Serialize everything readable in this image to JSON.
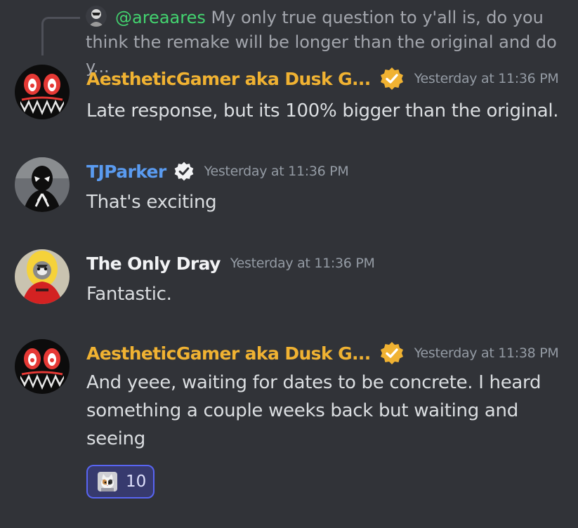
{
  "reply": {
    "author": "@areaares",
    "text": "My only true question to y'all is, do you think the remake will be longer than the original and do y..."
  },
  "messages": [
    {
      "author": "AestheticGamer aka Dusk G...",
      "author_color": "#f0b232",
      "verified": true,
      "timestamp": "Yesterday at 11:36 PM",
      "text": "Late response, but its 100% bigger than the original."
    },
    {
      "author": "TJParker",
      "author_color": "#5a9bf0",
      "verified": true,
      "timestamp": "Yesterday at 11:36 PM",
      "text": "That's exciting"
    },
    {
      "author": "The Only Dray",
      "author_color": "#f2f3f5",
      "verified": false,
      "timestamp": "Yesterday at 11:36 PM",
      "text": "Fantastic."
    },
    {
      "author": "AestheticGamer aka Dusk G...",
      "author_color": "#f0b232",
      "verified": true,
      "timestamp": "Yesterday at 11:38 PM",
      "text": "And yeee, waiting for dates to be concrete. I heard something a couple weeks back but waiting and seeing"
    }
  ],
  "reaction": {
    "emoji": "cat-emoji",
    "count": "10"
  },
  "colors": {
    "background": "#313338",
    "gold_username": "#f0b232",
    "blue_username": "#5a9bf0",
    "reply_author": "#43d36f",
    "reaction_border": "#5865f2"
  }
}
